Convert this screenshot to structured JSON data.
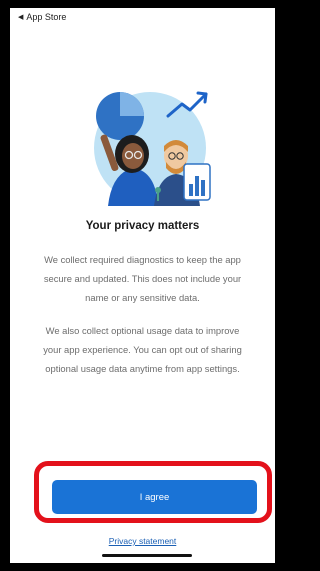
{
  "status_bar": {
    "back_glyph": "◀",
    "back_label": "App Store"
  },
  "hero": {
    "icon": "people-with-charts-illustration"
  },
  "title": "Your privacy matters",
  "paragraphs": [
    "We collect required diagnostics to keep the app secure and updated. This does not include your name or any sensitive data.",
    "We also collect optional usage data to improve your app experience. You can opt out of sharing optional usage data anytime from app settings."
  ],
  "buttons": {
    "agree": "I agree"
  },
  "links": {
    "privacy": "Privacy statement"
  },
  "colors": {
    "accent": "#1a73d6",
    "highlight": "#e3111b",
    "link": "#1a5fb4"
  }
}
